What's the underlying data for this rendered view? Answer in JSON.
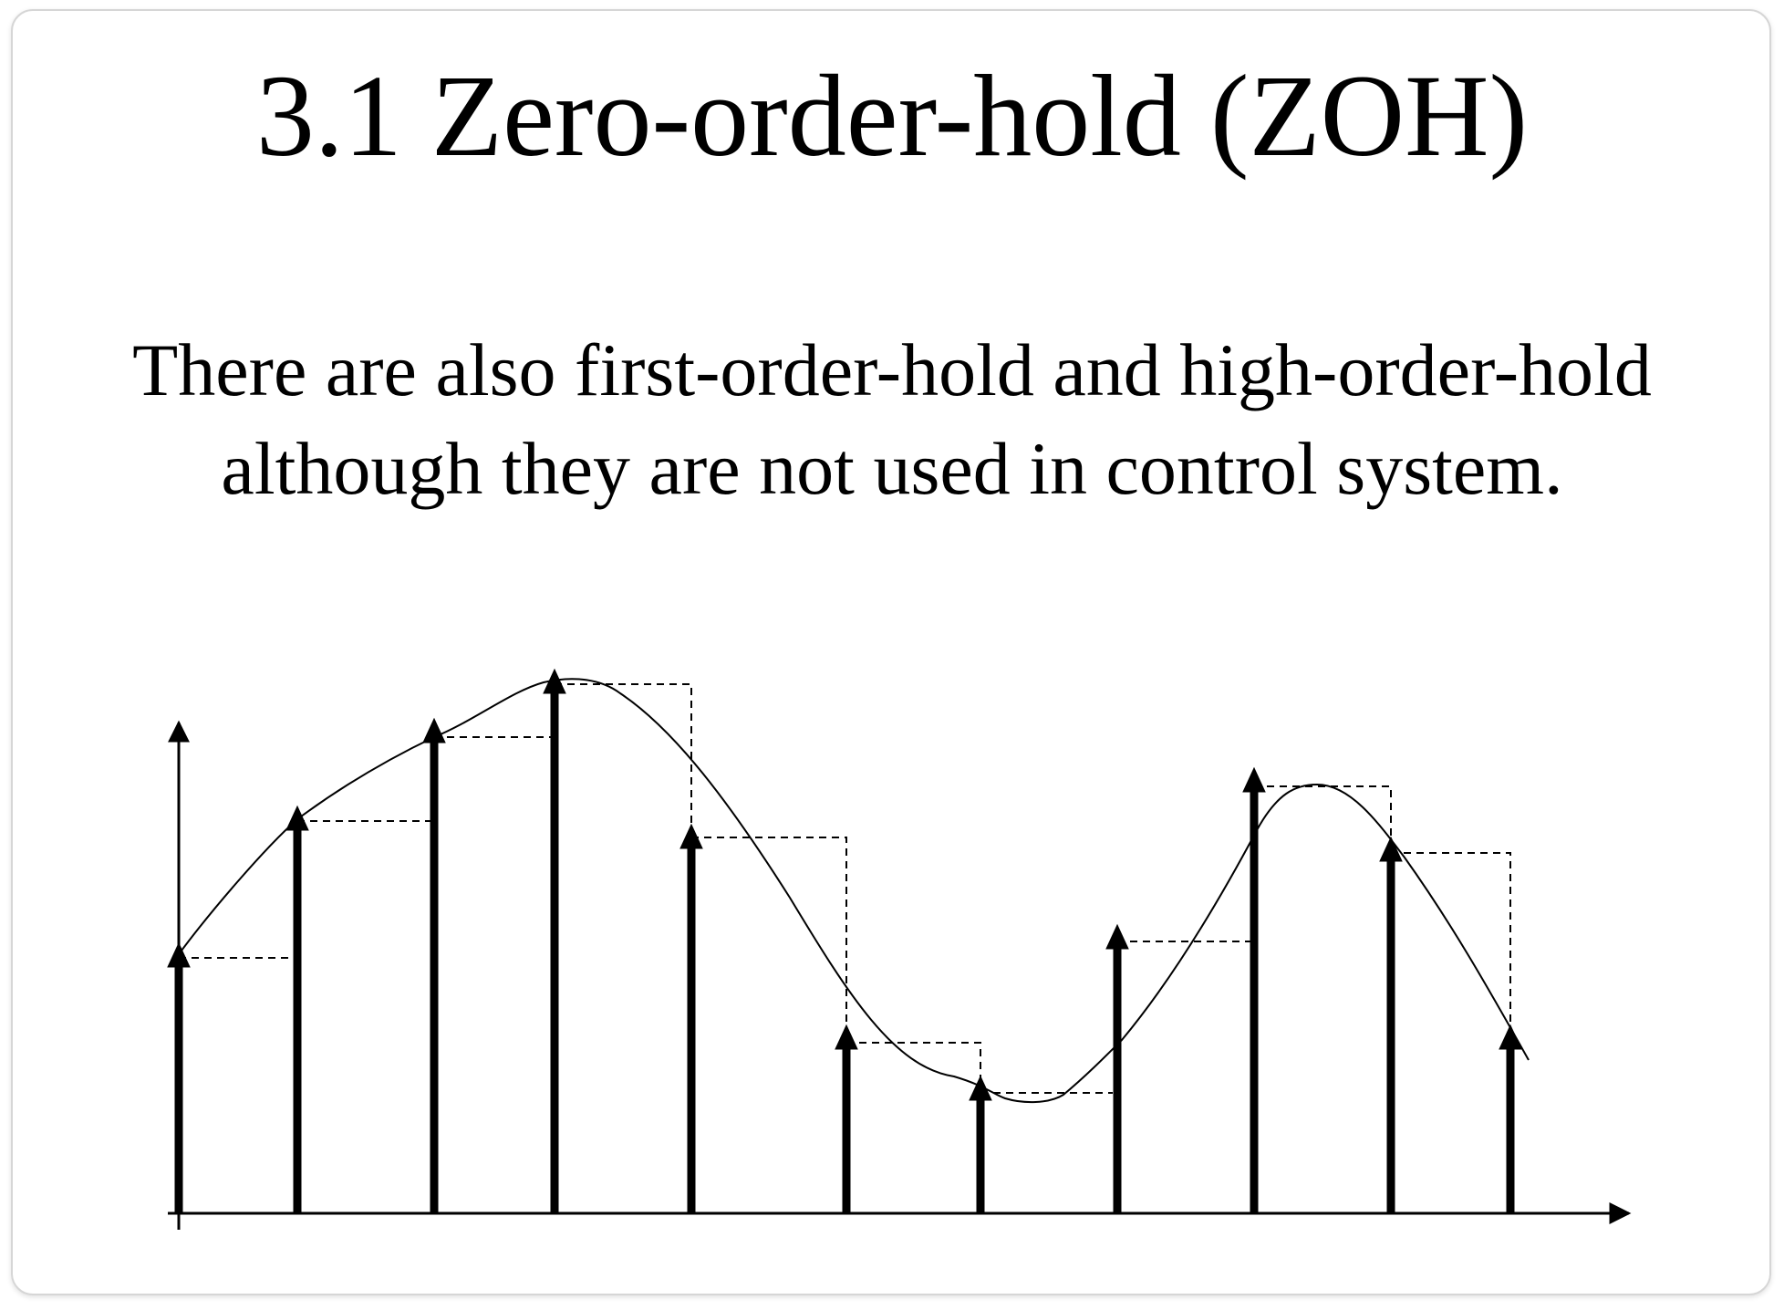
{
  "slide": {
    "title": "3.1 Zero-order-hold (ZOH)",
    "text_lines": [
      "There are also first-order-hold and high-order-hold",
      "although they are not used in control system."
    ]
  },
  "diagram": {
    "description_kind": "sampled signal with zero-order-hold",
    "samples": [
      {
        "x": 0,
        "value": 0.52
      },
      {
        "x": 1,
        "value": 0.79
      },
      {
        "x": 2,
        "value": 0.96
      },
      {
        "x": 3,
        "value": 1.07
      },
      {
        "x": 4,
        "value": 0.76
      },
      {
        "x": 5,
        "value": 0.33
      },
      {
        "x": 6,
        "value": 0.23
      },
      {
        "x": 7,
        "value": 0.56
      },
      {
        "x": 8,
        "value": 0.86
      },
      {
        "x": 9,
        "value": 0.73
      },
      {
        "x": 10,
        "value": 0.36
      }
    ],
    "colors": {
      "stroke": "#000000",
      "hold_line": "#000000",
      "curve": "#000000"
    }
  }
}
